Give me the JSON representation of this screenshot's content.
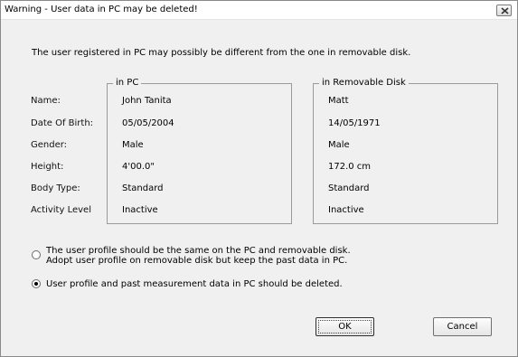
{
  "window": {
    "title": "Warning - User data in PC may be deleted!"
  },
  "message": "The user registered in PC may possibly be different from the one in removable disk.",
  "fields": {
    "labels": [
      "Name:",
      "Date Of Birth:",
      "Gender:",
      "Height:",
      "Body Type:",
      "Activity Level"
    ]
  },
  "pc_group": {
    "title": "in PC",
    "values": [
      "John Tanita",
      "05/05/2004",
      "Male",
      "4'00.0\"",
      "Standard",
      "Inactive"
    ]
  },
  "disk_group": {
    "title": "in Removable Disk",
    "values": [
      "Matt",
      "14/05/1971",
      "Male",
      "172.0 cm",
      "Standard",
      "Inactive"
    ]
  },
  "options": [
    {
      "line1": "The user profile should be the same on the PC and removable disk.",
      "line2": "Adopt user profile on removable disk but keep the past data in PC.",
      "selected": false
    },
    {
      "line1": "User profile and past measurement data in PC should be deleted.",
      "line2": "",
      "selected": true
    }
  ],
  "buttons": {
    "ok": "OK",
    "cancel": "Cancel"
  },
  "icons": {
    "close": "close-icon"
  }
}
